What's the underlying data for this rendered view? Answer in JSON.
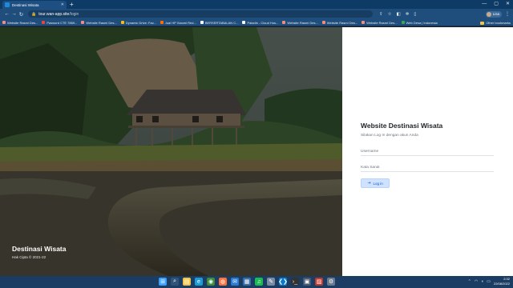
{
  "browser": {
    "tab_title": "Destinasi Wisata",
    "new_tab": "+",
    "url_host": "tour.wan-app.site",
    "url_path": "/login",
    "profile_name": "Lisa",
    "window_controls": [
      "—",
      "▢",
      "✕"
    ],
    "bookmarks": [
      {
        "label": "Website Rasmi Des...",
        "color": "#f28b82"
      },
      {
        "label": "Pasword CTE 7869...",
        "color": "#e8453c"
      },
      {
        "label": "Website Rasmi Des...",
        "color": "#f28b82"
      },
      {
        "label": "Dynamic Drive: Fav...",
        "color": "#fbbc04"
      },
      {
        "label": "Jual HP Xiaomi Red...",
        "color": "#ff6d00"
      },
      {
        "label": "BERSERTABALAN C...",
        "color": "#ffffff"
      },
      {
        "label": "Paladin - Cloud Hos...",
        "color": "#ffffff"
      },
      {
        "label": "Website Rasmi Des...",
        "color": "#f28b82"
      },
      {
        "label": "Website Rasmi Des...",
        "color": "#f28b82"
      },
      {
        "label": "Website Rasmi Des...",
        "color": "#f28b82"
      },
      {
        "label": "Web Desa | Indonesia",
        "color": "#34a853"
      }
    ],
    "other_bookmarks": "Other bookmarks"
  },
  "hero": {
    "title": "Destinasi Wisata",
    "copyright": "Hak Cipta © 2021-22"
  },
  "login": {
    "title": "Website Destinasi Wisata",
    "subtitle": "Silakan Log In dengan akun Anda",
    "username_placeholder": "Username",
    "password_placeholder": "Kata Sandi",
    "button_label": "Log in"
  },
  "taskbar": {
    "apps": [
      {
        "name": "windows-start-icon",
        "glyph": "⊞",
        "color": "#3aa0ff"
      },
      {
        "name": "search-icon",
        "glyph": "⌕",
        "color": "#2f5478"
      },
      {
        "name": "file-explorer-icon",
        "glyph": "▤",
        "color": "#f4c542"
      },
      {
        "name": "edge-icon",
        "glyph": "e",
        "color": "#1e9ad6"
      },
      {
        "name": "chrome-icon",
        "glyph": "◉",
        "color": "#3c8d3c"
      },
      {
        "name": "firefox-icon",
        "glyph": "◍",
        "color": "#ff7139"
      },
      {
        "name": "mail-icon",
        "glyph": "✉",
        "color": "#2b7bd6"
      },
      {
        "name": "store-icon",
        "glyph": "▦",
        "color": "#3a6ea5"
      },
      {
        "name": "spotify-icon",
        "glyph": "♫",
        "color": "#1db954"
      },
      {
        "name": "notepad-icon",
        "glyph": "✎",
        "color": "#7a8ba3"
      },
      {
        "name": "vscode-icon",
        "glyph": "❮❯",
        "color": "#0a7acc"
      },
      {
        "name": "terminal-icon",
        "glyph": "›_",
        "color": "#333333"
      },
      {
        "name": "calculator-icon",
        "glyph": "▣",
        "color": "#4a5a70"
      },
      {
        "name": "photos-icon",
        "glyph": "▨",
        "color": "#c0392b"
      },
      {
        "name": "settings-icon",
        "glyph": "⚙",
        "color": "#6b7b8f"
      }
    ],
    "time": "2:32",
    "date": "22/08/2022"
  }
}
